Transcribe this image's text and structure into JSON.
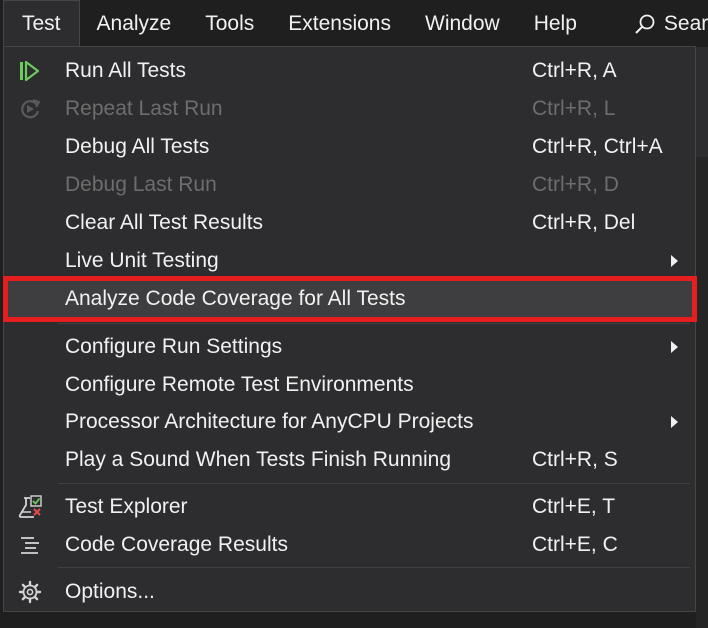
{
  "menubar": {
    "items": [
      {
        "label": "Test",
        "active": true
      },
      {
        "label": "Analyze",
        "active": false
      },
      {
        "label": "Tools",
        "active": false
      },
      {
        "label": "Extensions",
        "active": false
      },
      {
        "label": "Window",
        "active": false
      },
      {
        "label": "Help",
        "active": false
      }
    ],
    "search_label": "Searc"
  },
  "menu": {
    "items": [
      {
        "label": "Run All Tests",
        "shortcut": "Ctrl+R, A",
        "icon": "run-all-tests-icon",
        "enabled": true
      },
      {
        "label": "Repeat Last Run",
        "shortcut": "Ctrl+R, L",
        "icon": "repeat-last-run-icon",
        "enabled": false
      },
      {
        "label": "Debug All Tests",
        "shortcut": "Ctrl+R, Ctrl+A",
        "enabled": true
      },
      {
        "label": "Debug Last Run",
        "shortcut": "Ctrl+R, D",
        "enabled": false
      },
      {
        "label": "Clear All Test Results",
        "shortcut": "Ctrl+R, Del",
        "enabled": true
      },
      {
        "label": "Live Unit Testing",
        "submenu": true,
        "enabled": true
      },
      {
        "label": "Analyze Code Coverage for All Tests",
        "enabled": true,
        "highlighted": true
      },
      {
        "label": "Configure Run Settings",
        "submenu": true,
        "enabled": true
      },
      {
        "label": "Configure Remote Test Environments",
        "enabled": true
      },
      {
        "label": "Processor Architecture for AnyCPU Projects",
        "submenu": true,
        "enabled": true
      },
      {
        "label": "Play a Sound When Tests Finish Running",
        "shortcut": "Ctrl+R, S",
        "enabled": true
      },
      {
        "label": "Test Explorer",
        "shortcut": "Ctrl+E, T",
        "icon": "test-explorer-icon",
        "enabled": true
      },
      {
        "label": "Code Coverage Results",
        "shortcut": "Ctrl+E, C",
        "icon": "code-coverage-results-icon",
        "enabled": true
      },
      {
        "label": "Options...",
        "icon": "gear-icon",
        "enabled": true
      }
    ]
  },
  "colors": {
    "menu_background": "#2d2d30",
    "menu_text": "#f1f1f1",
    "disabled_text": "#6d6d6d",
    "highlight_outline": "#e51f1f",
    "run_icon_green": "#6ccb5f"
  }
}
